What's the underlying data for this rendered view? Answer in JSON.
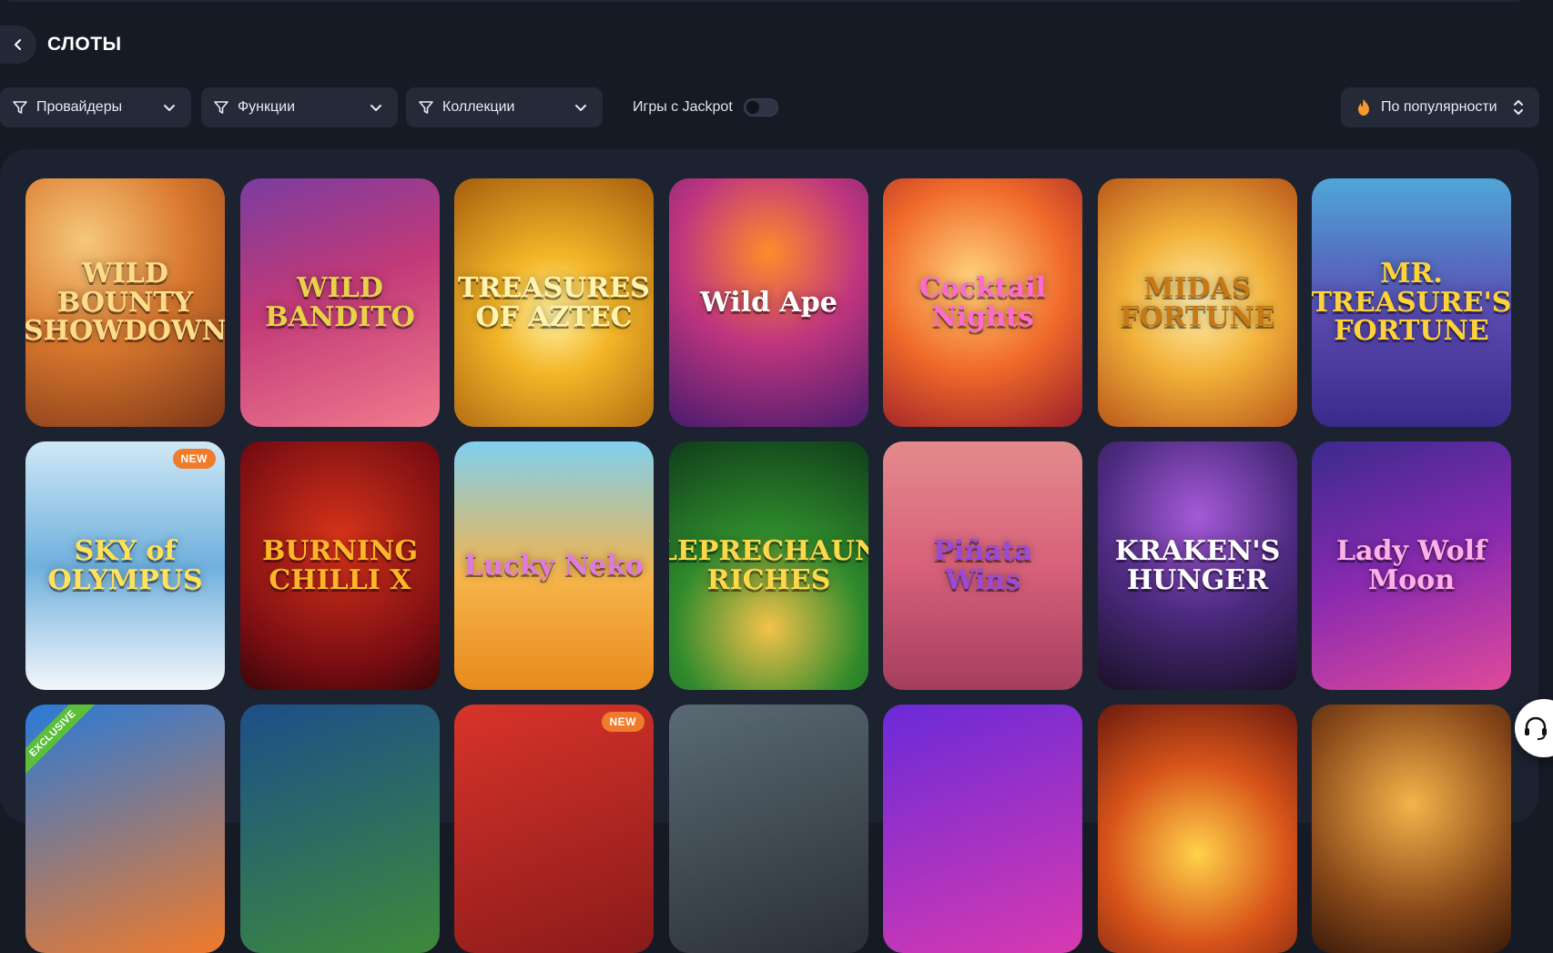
{
  "header": {
    "title": "СЛОТЫ"
  },
  "filters": {
    "providers_label": "Провайдеры",
    "functions_label": "Функции",
    "collections_label": "Коллекции",
    "jackpot_label": "Игры с Jackpot",
    "jackpot_enabled": false,
    "sort_label": "По популярности"
  },
  "colors": {
    "background": "#151a24",
    "panel": "#1c2230",
    "control": "#242a38",
    "accent_new": "#f07b2a",
    "accent_exclusive": "#5bbf3a"
  },
  "games": [
    {
      "title": "WILD BOUNTY SHOWDOWN",
      "badge": ""
    },
    {
      "title": "WILD BANDITO",
      "badge": ""
    },
    {
      "title": "TREASURES OF AZTEC",
      "badge": ""
    },
    {
      "title": "Wild Ape",
      "badge": ""
    },
    {
      "title": "Cocktail Nights",
      "badge": ""
    },
    {
      "title": "MIDAS FORTUNE",
      "badge": ""
    },
    {
      "title": "MR. TREASURE'S FORTUNE",
      "badge": ""
    },
    {
      "title": "SKY of OLYMPUS",
      "badge": "NEW"
    },
    {
      "title": "BURNING CHILLI X",
      "badge": ""
    },
    {
      "title": "Lucky Neko",
      "badge": ""
    },
    {
      "title": "LEPRECHAUN RICHES",
      "badge": ""
    },
    {
      "title": "Piñata Wins",
      "badge": ""
    },
    {
      "title": "KRAKEN'S HUNGER",
      "badge": ""
    },
    {
      "title": "Lady Wolf Moon",
      "badge": ""
    },
    {
      "title": "",
      "badge": "EXCLUSIVE"
    },
    {
      "title": "",
      "badge": ""
    },
    {
      "title": "",
      "badge": "NEW"
    },
    {
      "title": "",
      "badge": ""
    },
    {
      "title": "",
      "badge": ""
    },
    {
      "title": "",
      "badge": ""
    },
    {
      "title": "",
      "badge": ""
    }
  ],
  "icons": {
    "back": "chevron-left-icon",
    "filter": "funnel-icon",
    "dropdown": "chevron-down-icon",
    "sort": "fire-icon",
    "sort_toggle": "up-down-icon",
    "support": "headset-icon"
  }
}
